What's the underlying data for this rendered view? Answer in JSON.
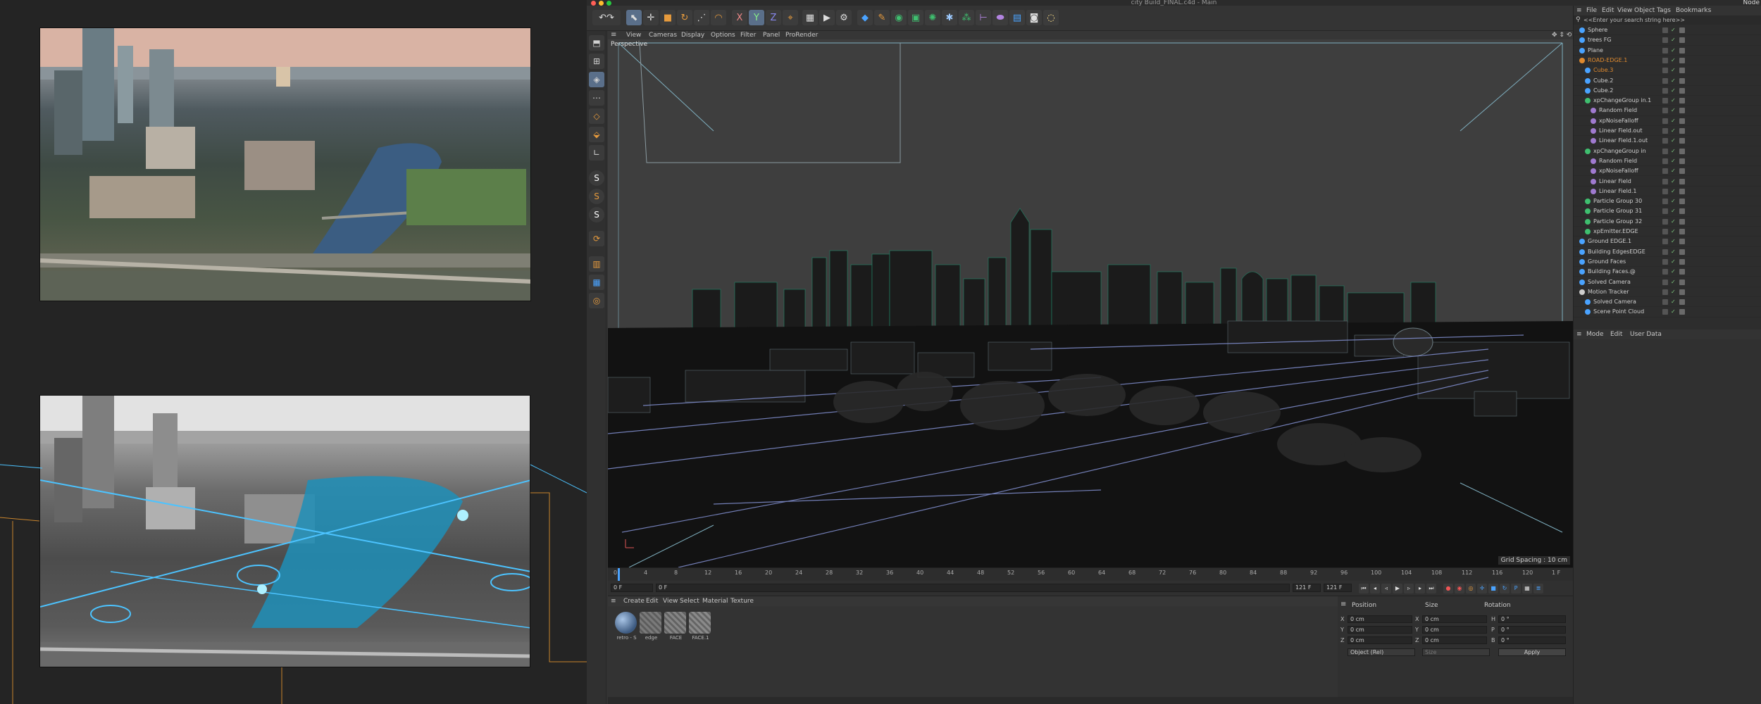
{
  "window": {
    "title": "city Build_FINAL.c4d - Main",
    "corner_label": "Node"
  },
  "toolbar": {
    "axis_x": "X",
    "axis_y": "Y",
    "axis_z": "Z"
  },
  "viewport": {
    "menu": [
      "View",
      "Cameras",
      "Display",
      "Options",
      "Filter",
      "Panel",
      "ProRender"
    ],
    "label": "Perspective",
    "grid_spacing": "Grid Spacing : 10 cm"
  },
  "timeline": {
    "ticks": [
      "0",
      "4",
      "8",
      "12",
      "16",
      "20",
      "24",
      "28",
      "32",
      "36",
      "40",
      "44",
      "48",
      "52",
      "56",
      "60",
      "64",
      "68",
      "72",
      "76",
      "80",
      "84",
      "88",
      "92",
      "96",
      "100",
      "104",
      "108",
      "112",
      "116",
      "120"
    ],
    "frame_end_label": "1 F",
    "start_field": "0 F",
    "current_field": "0 F",
    "end_field_1": "121 F",
    "end_field_2": "121 F"
  },
  "material_panel": {
    "menu": [
      "Create",
      "Edit",
      "View",
      "Select",
      "Material",
      "Texture"
    ],
    "materials": [
      {
        "name": "retro - S",
        "color": "#5c7fa6"
      },
      {
        "name": "edge",
        "color": "#6d6d6d"
      },
      {
        "name": "FACE",
        "color": "#777777"
      },
      {
        "name": "FACE.1",
        "color": "#7a7a7a"
      }
    ]
  },
  "coord_panel": {
    "headers": [
      "Position",
      "Size",
      "Rotation"
    ],
    "rows": [
      {
        "axis": "X",
        "pos": "0 cm",
        "size_axis": "X",
        "size": "0 cm",
        "rot_axis": "H",
        "rot": "0 °"
      },
      {
        "axis": "Y",
        "pos": "0 cm",
        "size_axis": "Y",
        "size": "0 cm",
        "rot_axis": "P",
        "rot": "0 °"
      },
      {
        "axis": "Z",
        "pos": "0 cm",
        "size_axis": "Z",
        "size": "0 cm",
        "rot_axis": "B",
        "rot": "0 °"
      }
    ],
    "mode_select": "Object (Rel)",
    "size_select": "Size",
    "apply_label": "Apply"
  },
  "object_manager": {
    "menu": [
      "File",
      "Edit",
      "View",
      "Object",
      "Tags",
      "Bookmarks"
    ],
    "search_placeholder": "<<Enter your search string here>>",
    "objects": [
      {
        "name": "Sphere",
        "indent": 0,
        "color": "#4aa3ff",
        "highlight": false
      },
      {
        "name": "trees FG",
        "indent": 0,
        "color": "#4aa3ff",
        "highlight": false
      },
      {
        "name": "Plane",
        "indent": 0,
        "color": "#4aa3ff",
        "highlight": false
      },
      {
        "name": "ROAD-EDGE.1",
        "indent": 0,
        "color": "#e08a2e",
        "highlight": true
      },
      {
        "name": "Cube.3",
        "indent": 1,
        "color": "#4aa3ff",
        "highlight": true
      },
      {
        "name": "Cube.2",
        "indent": 1,
        "color": "#4aa3ff",
        "highlight": false
      },
      {
        "name": "Cube.2",
        "indent": 1,
        "color": "#4aa3ff",
        "highlight": false
      },
      {
        "name": "xpChangeGroup in.1",
        "indent": 1,
        "color": "#3fbf6f",
        "highlight": false
      },
      {
        "name": "Random Field",
        "indent": 2,
        "color": "#a07ad0",
        "highlight": false
      },
      {
        "name": "xpNoiseFalloff",
        "indent": 2,
        "color": "#a07ad0",
        "highlight": false
      },
      {
        "name": "Linear Field.out",
        "indent": 2,
        "color": "#a07ad0",
        "highlight": false
      },
      {
        "name": "Linear Field.1.out",
        "indent": 2,
        "color": "#a07ad0",
        "highlight": false
      },
      {
        "name": "xpChangeGroup in",
        "indent": 1,
        "color": "#3fbf6f",
        "highlight": false
      },
      {
        "name": "Random Field",
        "indent": 2,
        "color": "#a07ad0",
        "highlight": false
      },
      {
        "name": "xpNoiseFalloff",
        "indent": 2,
        "color": "#a07ad0",
        "highlight": false
      },
      {
        "name": "Linear Field",
        "indent": 2,
        "color": "#a07ad0",
        "highlight": false
      },
      {
        "name": "Linear Field.1",
        "indent": 2,
        "color": "#a07ad0",
        "highlight": false
      },
      {
        "name": "Particle Group 30",
        "indent": 1,
        "color": "#3fbf6f",
        "highlight": false
      },
      {
        "name": "Particle Group 31",
        "indent": 1,
        "color": "#3fbf6f",
        "highlight": false
      },
      {
        "name": "Particle Group 32",
        "indent": 1,
        "color": "#3fbf6f",
        "highlight": false
      },
      {
        "name": "xpEmitter.EDGE",
        "indent": 1,
        "color": "#3fbf6f",
        "highlight": false
      },
      {
        "name": "Ground EDGE.1",
        "indent": 0,
        "color": "#4aa3ff",
        "highlight": false
      },
      {
        "name": "Building EdgesEDGE",
        "indent": 0,
        "color": "#4aa3ff",
        "highlight": false
      },
      {
        "name": "Ground Faces",
        "indent": 0,
        "color": "#4aa3ff",
        "highlight": false
      },
      {
        "name": "Building Faces.@",
        "indent": 0,
        "color": "#4aa3ff",
        "highlight": false
      },
      {
        "name": "Solved Camera",
        "indent": 0,
        "color": "#4aa3ff",
        "highlight": false
      },
      {
        "name": "Motion Tracker",
        "indent": 0,
        "color": "#cfcfcf",
        "highlight": false
      },
      {
        "name": "Solved Camera",
        "indent": 1,
        "color": "#4aa3ff",
        "highlight": false
      },
      {
        "name": "Scene Point Cloud",
        "indent": 1,
        "color": "#4aa3ff",
        "highlight": false
      }
    ]
  },
  "attributes": {
    "menu": [
      "Mode",
      "Edit",
      "User Data"
    ]
  }
}
